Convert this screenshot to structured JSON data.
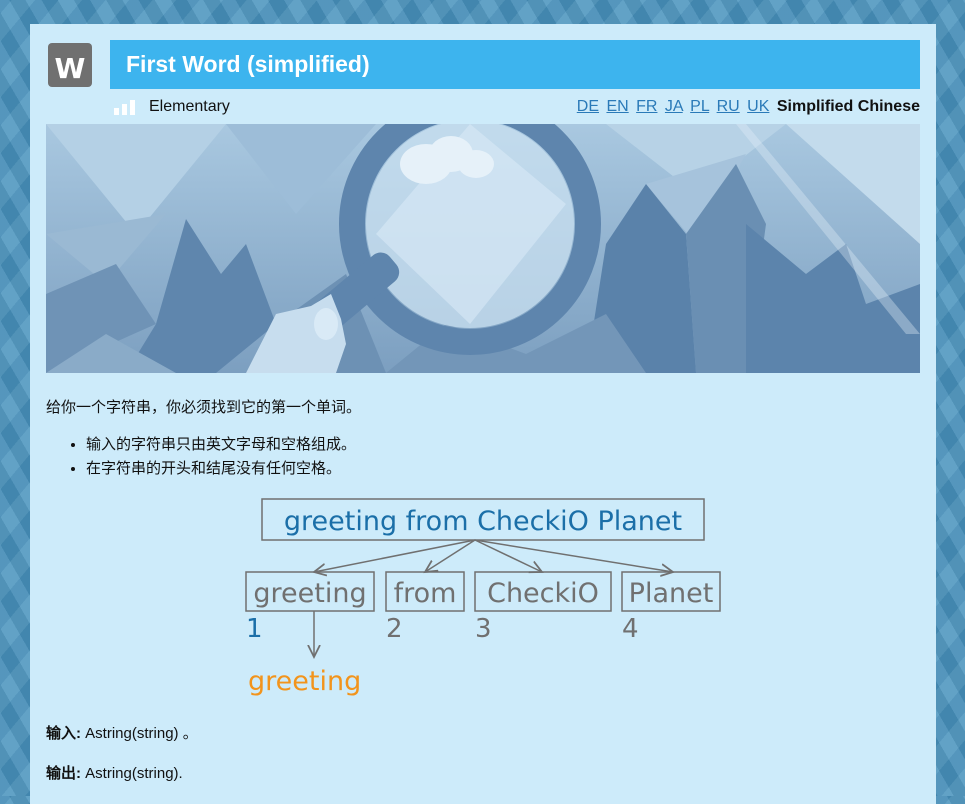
{
  "header": {
    "icon_letter": "W",
    "title": "First Word (simplified)",
    "level": "Elementary"
  },
  "languages": {
    "links": [
      "DE",
      "EN",
      "FR",
      "JA",
      "PL",
      "RU",
      "UK"
    ],
    "active": "Simplified Chinese"
  },
  "description": {
    "intro": "给你一个字符串，你必须找到它的第一个单词。",
    "bullets": [
      "输入的字符串只由英文字母和空格组成。",
      "在字符串的开头和结尾没有任何空格。"
    ]
  },
  "diagram": {
    "sentence": "greeting from CheckiO Planet",
    "words": [
      "greeting",
      "from",
      "CheckiO",
      "Planet"
    ],
    "indices": [
      "1",
      "2",
      "3",
      "4"
    ],
    "result": "greeting"
  },
  "io": {
    "input_label": "输入:",
    "input_text": "Astring(string) 。",
    "output_label": "输出:",
    "output_text": "Astring(string)."
  },
  "colors": {
    "title_bar": "#3db4ee",
    "panel": "#cdebfa",
    "link": "#2a7ab8",
    "diagram_blue": "#1b6fa8",
    "diagram_orange": "#f2941c",
    "diagram_gray": "#707070"
  }
}
